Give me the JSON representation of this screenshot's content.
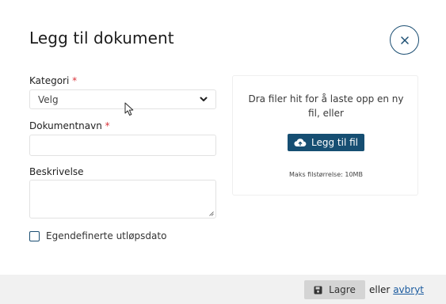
{
  "dialog": {
    "title": "Legg til dokument"
  },
  "form": {
    "category": {
      "label": "Kategori",
      "required_mark": "*",
      "value": "Velg"
    },
    "document_name": {
      "label": "Dokumentnavn",
      "required_mark": "*",
      "value": ""
    },
    "description": {
      "label": "Beskrivelse",
      "value": ""
    },
    "custom_expiry": {
      "label": "Egendefinerte utløpsdato",
      "checked": false
    }
  },
  "upload": {
    "instructions": "Dra filer hit for å laste opp en ny fil, eller",
    "button_label": "Legg til fil",
    "max_size": "Maks filstørrelse: 10MB"
  },
  "footer": {
    "save_label": "Lagre",
    "or_text": "eller",
    "cancel_label": "avbryt"
  },
  "colors": {
    "primary": "#164e72",
    "required": "#d9333a",
    "link": "#1a5a9e",
    "footer_bg": "#f1f1f1",
    "save_bg": "#d4d4d4"
  },
  "icons": [
    "close-icon",
    "chevron-down-icon",
    "cloud-upload-icon",
    "save-icon",
    "mouse-cursor-icon"
  ]
}
